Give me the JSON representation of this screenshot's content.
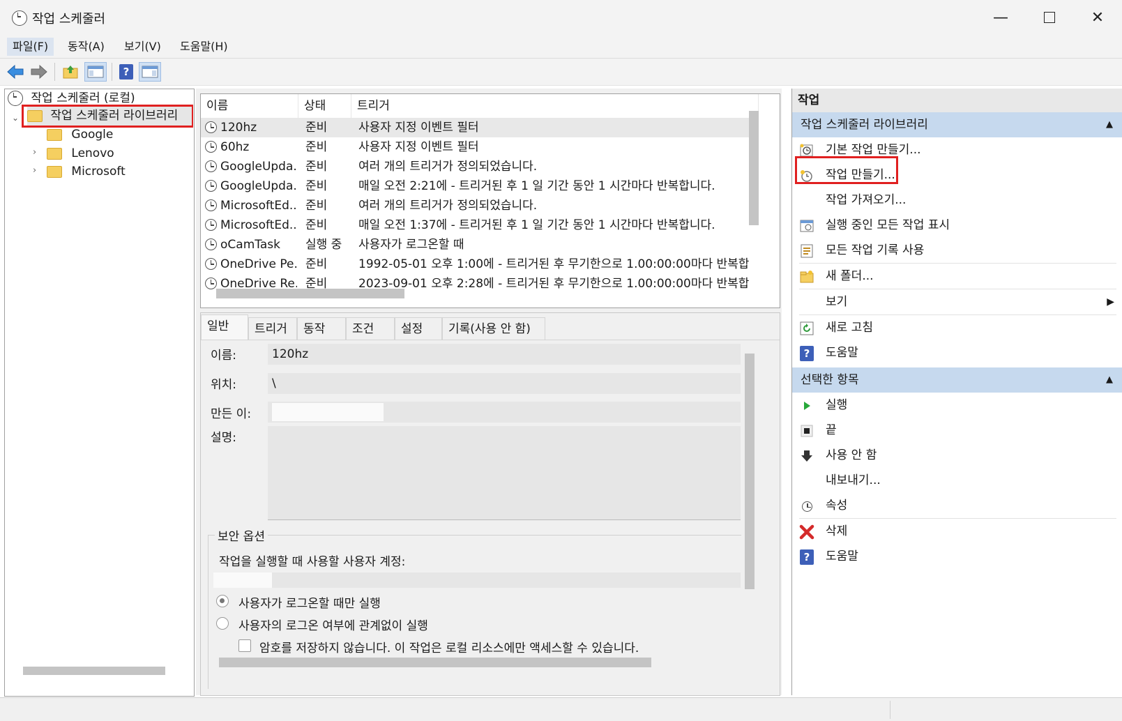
{
  "window": {
    "title": "작업 스케줄러"
  },
  "menu": [
    "파일(F)",
    "동작(A)",
    "보기(V)",
    "도움말(H)"
  ],
  "tree": {
    "root": "작업 스케줄러 (로컬)",
    "library": "작업 스케줄러 라이브러리",
    "folders": [
      "Google",
      "Lenovo",
      "Microsoft"
    ]
  },
  "task_list": {
    "columns": [
      "이름",
      "상태",
      "트리거"
    ],
    "rows": [
      {
        "name": "120hz",
        "status": "준비",
        "trigger": "사용자 지정 이벤트 필터"
      },
      {
        "name": "60hz",
        "status": "준비",
        "trigger": "사용자 지정 이벤트 필터"
      },
      {
        "name": "GoogleUpda...",
        "status": "준비",
        "trigger": "여러 개의 트리거가 정의되었습니다."
      },
      {
        "name": "GoogleUpda...",
        "status": "준비",
        "trigger": "매일 오전 2:21에 - 트리거된 후 1 일 기간 동안 1 시간마다 반복합니다."
      },
      {
        "name": "MicrosoftEd...",
        "status": "준비",
        "trigger": "여러 개의 트리거가 정의되었습니다."
      },
      {
        "name": "MicrosoftEd...",
        "status": "준비",
        "trigger": "매일 오전 1:37에 - 트리거된 후 1 일 기간 동안 1 시간마다 반복합니다."
      },
      {
        "name": "oCamTask",
        "status": "실행 중",
        "trigger": "사용자가 로그온할 때"
      },
      {
        "name": "OneDrive Pe...",
        "status": "준비",
        "trigger": "1992-05-01 오후 1:00에 - 트리거된 후 무기한으로 1.00:00:00마다 반복합"
      },
      {
        "name": "OneDrive Re...",
        "status": "준비",
        "trigger": "2023-09-01 오후 2:28에 - 트리거된 후 무기한으로 1.00:00:00마다 반복합"
      }
    ]
  },
  "detail": {
    "tabs": [
      "일반",
      "트리거",
      "동작",
      "조건",
      "설정",
      "기록(사용 안 함)"
    ],
    "name_label": "이름:",
    "name_value": "120hz",
    "location_label": "위치:",
    "location_value": "\\",
    "author_label": "만든 이:",
    "author_value": "",
    "description_label": "설명:",
    "security_title": "보안 옵션",
    "account_label": "작업을 실행할 때 사용할 사용자 계정:",
    "radio_logged_on": "사용자가 로그온할 때만 실행",
    "radio_whether": "사용자의 로그온 여부에 관계없이 실행",
    "checkbox_no_password": "암호를 저장하지 않습니다. 이 작업은 로컬 리소스에만 액세스할 수 있습니다."
  },
  "actions": {
    "header": "작업",
    "group1_title": "작업 스케줄러 라이브러리",
    "group1_items": [
      {
        "label": "기본 작업 만들기...",
        "icon": "basic-task-icon"
      },
      {
        "label": "작업 만들기...",
        "icon": "create-task-icon"
      },
      {
        "label": "작업 가져오기...",
        "icon": ""
      },
      {
        "label": "실행 중인 모든 작업 표시",
        "icon": "running-tasks-icon"
      },
      {
        "label": "모든 작업 기록 사용",
        "icon": "history-icon"
      },
      {
        "label": "새 폴더...",
        "icon": "new-folder-icon"
      },
      {
        "label": "보기",
        "icon": ""
      },
      {
        "label": "새로 고침",
        "icon": "refresh-icon"
      },
      {
        "label": "도움말",
        "icon": "help-icon"
      }
    ],
    "group2_title": "선택한 항목",
    "group2_items": [
      {
        "label": "실행",
        "icon": "run-icon"
      },
      {
        "label": "끝",
        "icon": "end-icon"
      },
      {
        "label": "사용 안 함",
        "icon": "disable-icon"
      },
      {
        "label": "내보내기...",
        "icon": ""
      },
      {
        "label": "속성",
        "icon": "properties-icon"
      },
      {
        "label": "삭제",
        "icon": "delete-icon"
      },
      {
        "label": "도움말",
        "icon": "help-icon"
      }
    ]
  },
  "colors": {
    "highlight_border": "#e02020",
    "group_header": "#c6d9ee",
    "selected_row": "#e8e8e8"
  }
}
